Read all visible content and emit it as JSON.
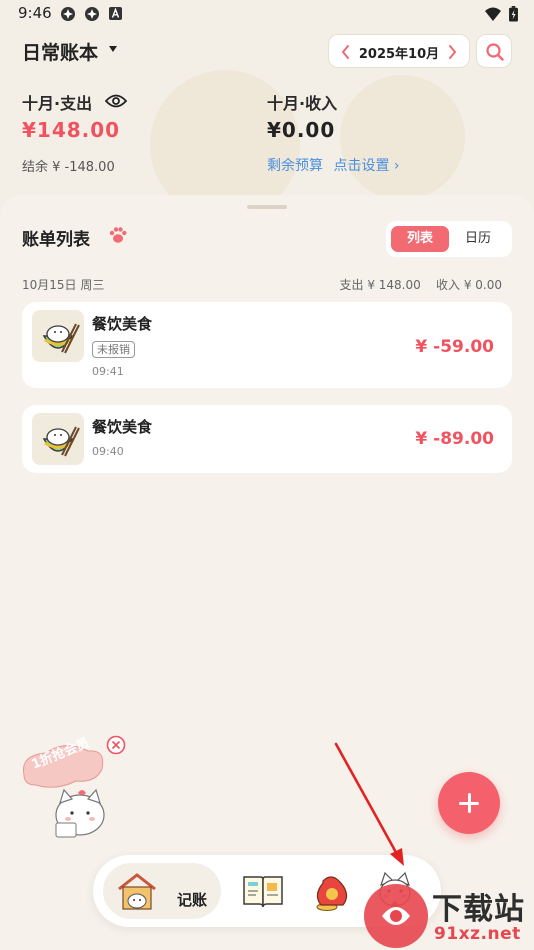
{
  "status_bar": {
    "time": "9:46",
    "icons": [
      "app-notification-icon",
      "app-notification-icon",
      "a-badge-icon",
      "wifi-icon",
      "battery-icon"
    ]
  },
  "header": {
    "book_title": "日常账本",
    "month": "2025年10月",
    "expense_label": "十月·支出",
    "expense_amount": "¥148.00",
    "income_label": "十月·收入",
    "income_amount": "¥0.00",
    "balance": "结余 ¥ -148.00",
    "budget_label": "剩余预算",
    "budget_action": "点击设置 ›"
  },
  "bill_list": {
    "title": "账单列表",
    "tabs": {
      "list": "列表",
      "calendar": "日历"
    },
    "day": {
      "date": "10月15日 周三",
      "summary": "支出 ¥ 148.00    收入 ¥ 0.00"
    },
    "items": [
      {
        "category": "餐饮美食",
        "tag": "未报销",
        "time": "09:41",
        "amount": "¥ -59.00"
      },
      {
        "category": "餐饮美食",
        "time": "09:40",
        "amount": "¥ -89.00"
      }
    ]
  },
  "promo": {
    "text": "1折抢会员"
  },
  "bottom_nav": {
    "active_label": "记账"
  },
  "watermark": {
    "brand": "下载站",
    "domain": "91xz.net"
  },
  "colors": {
    "accent": "#f26a72",
    "amount_red": "#f0535f",
    "link_blue": "#4a8fe0",
    "background": "#f4efe6"
  }
}
